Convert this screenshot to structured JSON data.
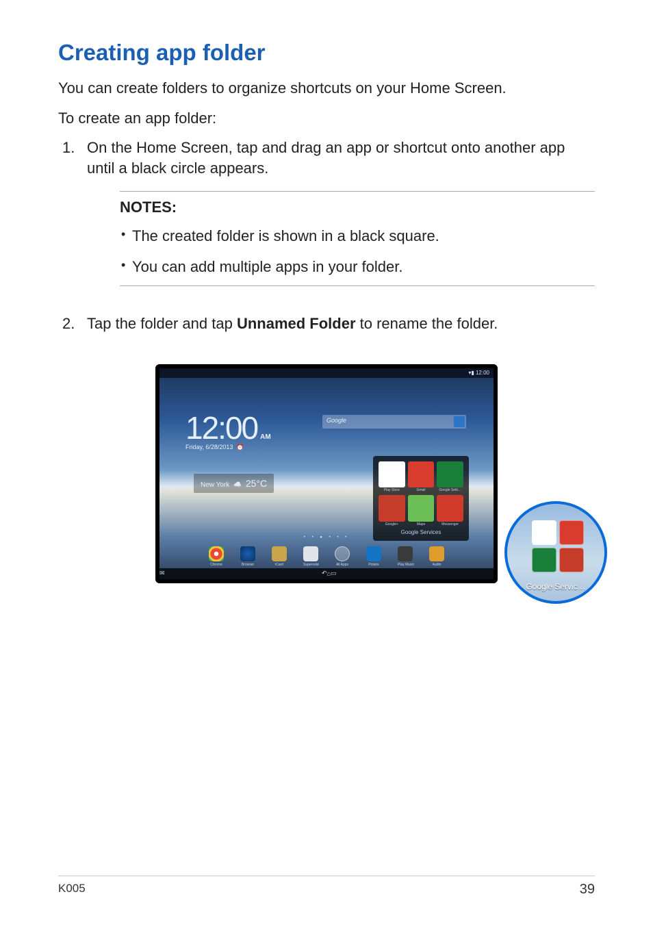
{
  "title": "Creating app folder",
  "intro1": "You can create folders to organize shortcuts on your Home Screen.",
  "intro2": "To create an app folder:",
  "steps": [
    "On the Home Screen, tap and drag an app or shortcut onto another app until a black circle appears.",
    "Tap the folder and tap Unnamed Folder to rename the folder."
  ],
  "step2_bold": "Unnamed Folder",
  "notes": {
    "heading": "NOTES:",
    "items": [
      "The created folder is shown in a black square.",
      "You can add multiple apps in your folder."
    ]
  },
  "tablet": {
    "status_time": "12:00",
    "clock_time": "12:00",
    "clock_ampm": "AM",
    "clock_date": "Friday, 6/28/2013",
    "weather_city": "New York",
    "weather_temp": "25°C",
    "search_placeholder": "Google",
    "folder_apps": [
      {
        "name": "Play Store",
        "bg": "#fff"
      },
      {
        "name": "Gmail",
        "bg": "#d83c2e"
      },
      {
        "name": "Google Setti…",
        "bg": "#1a7f3b"
      },
      {
        "name": "Google+",
        "bg": "#c63c2a"
      },
      {
        "name": "Maps",
        "bg": "#6cbf57"
      },
      {
        "name": "Messenger",
        "bg": "#cf3a2b"
      }
    ],
    "folder_name": "Google Services",
    "dock": [
      {
        "name": "Chrome",
        "bg": "radial-gradient(circle,#fff 20%,#e84b32 22% 55%,#f4c63a 55% 75%,#2aa94f 75%)"
      },
      {
        "name": "Browser",
        "bg": "radial-gradient(circle,#1a5fb4,#083364)"
      },
      {
        "name": "iCard",
        "bg": "#c8a44a"
      },
      {
        "name": "Supernote",
        "bg": "#e1e4e8"
      },
      {
        "name": "All Apps",
        "bg": "rgba(255,255,255,.28)"
      },
      {
        "name": "Polaris",
        "bg": "#1573c6"
      },
      {
        "name": "Play Music",
        "bg": "#3a3a3a"
      },
      {
        "name": "Audio",
        "bg": "#e09b2d"
      }
    ],
    "zoom_label": "Google Servic…",
    "zoom_apps": [
      {
        "bg": "#fff"
      },
      {
        "bg": "#d83c2e"
      },
      {
        "bg": "#1a7f3b"
      },
      {
        "bg": "#c63c2a"
      }
    ]
  },
  "footer": {
    "left": "K005",
    "right": "39"
  }
}
